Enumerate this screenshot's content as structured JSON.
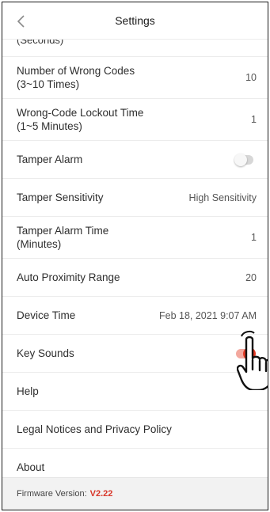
{
  "header": {
    "title": "Settings",
    "back_icon": "chevron-left-icon"
  },
  "cut_row": {
    "label": "(Seconds)"
  },
  "rows": [
    {
      "label_line1": "Number of Wrong Codes",
      "label_line2": "(3~10 Times)",
      "value": "10"
    },
    {
      "label_line1": "Wrong-Code Lockout Time",
      "label_line2": "(1~5 Minutes)",
      "value": "1"
    },
    {
      "label": "Tamper Alarm",
      "toggle": "off"
    },
    {
      "label": "Tamper Sensitivity",
      "value": "High Sensitivity"
    },
    {
      "label_line1": "Tamper Alarm Time",
      "label_line2": "(Minutes)",
      "value": "1"
    },
    {
      "label": "Auto Proximity Range",
      "value": "20"
    },
    {
      "label": "Device Time",
      "value": "Feb 18, 2021 9:07 AM"
    },
    {
      "label": "Key Sounds",
      "toggle": "on"
    },
    {
      "label": "Help"
    },
    {
      "label": "Legal Notices and Privacy Policy"
    },
    {
      "label": "About"
    }
  ],
  "footer": {
    "label": "Firmware Version:",
    "version": "V2.22"
  },
  "colors": {
    "accent": "#e53a25",
    "toggle_on_track": "#f3a89e",
    "toggle_off_track": "#d7d7d7",
    "footer_bg": "#f2f2f2"
  },
  "overlay": {
    "icon": "tapping-hand-icon"
  }
}
